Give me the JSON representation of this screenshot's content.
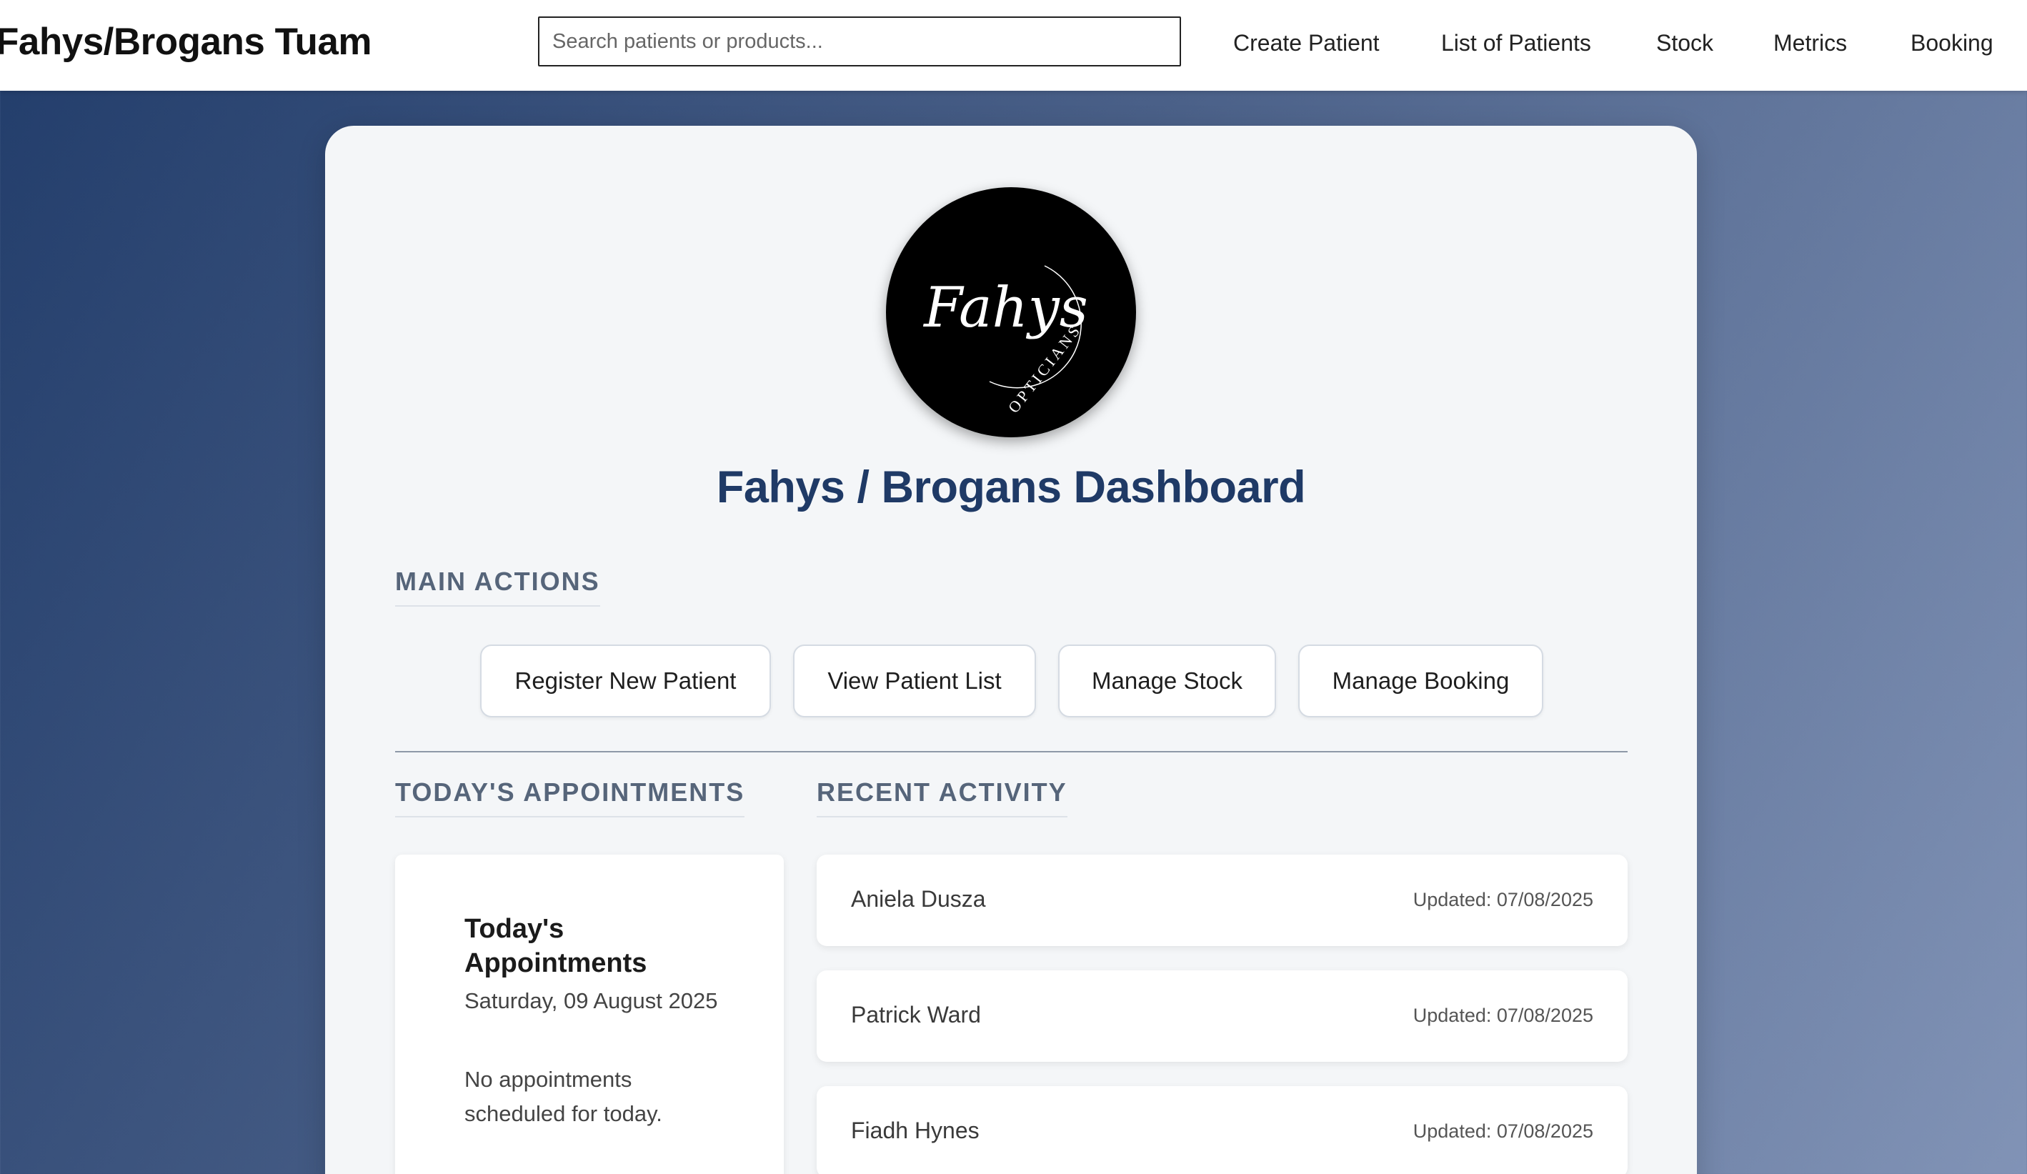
{
  "header": {
    "brand": "Fahys/Brogans Tuam",
    "search_placeholder": "Search patients or products...",
    "nav": [
      "Create Patient",
      "List of Patients",
      "Stock",
      "Metrics",
      "Booking"
    ]
  },
  "dashboard": {
    "title": "Fahys / Brogans Dashboard",
    "logo": {
      "script": "Fahys",
      "subtitle": "OPTICIANS"
    },
    "main_actions": {
      "heading": "MAIN ACTIONS",
      "buttons": [
        "Register New Patient",
        "View Patient List",
        "Manage Stock",
        "Manage Booking"
      ]
    },
    "appointments": {
      "heading": "TODAY'S APPOINTMENTS",
      "box_title": "Today's Appointments",
      "date": "Saturday, 09 August 2025",
      "empty_text": "No appointments scheduled for today."
    },
    "recent_activity": {
      "heading": "RECENT ACTIVITY",
      "items": [
        {
          "name": "Aniela Dusza",
          "updated": "Updated: 07/08/2025"
        },
        {
          "name": "Patrick Ward",
          "updated": "Updated: 07/08/2025"
        },
        {
          "name": "Fiadh Hynes",
          "updated": "Updated: 07/08/2025"
        }
      ]
    }
  },
  "colors": {
    "title_blue": "#1f3a66",
    "section_grey": "#56657a",
    "background_gradient_start": "#223d6b",
    "background_gradient_end": "#8193b6"
  }
}
